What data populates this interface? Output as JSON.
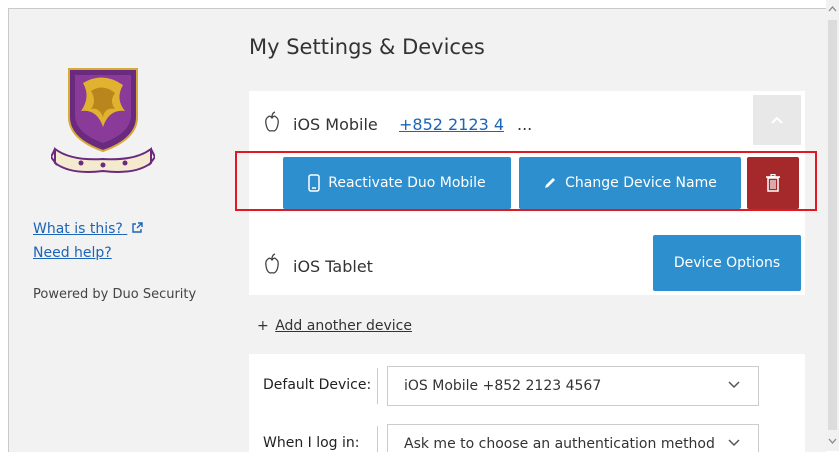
{
  "page": {
    "title": "My Settings & Devices"
  },
  "sidebar": {
    "what_is_this": "What is this?",
    "need_help": "Need help?",
    "powered_by": "Powered by Duo Security"
  },
  "devices": [
    {
      "name": "iOS Mobile",
      "phone": "+852 2123 4",
      "ellipsis": "...",
      "icon": "apple-icon",
      "expanded": true
    },
    {
      "name": "iOS Tablet",
      "icon": "apple-icon",
      "options_label": "Device Options"
    }
  ],
  "device_actions": {
    "reactivate_label": "Reactivate Duo Mobile",
    "rename_label": "Change Device Name",
    "delete_icon": "trash-icon"
  },
  "add_device": {
    "plus": "+",
    "label": "Add another device"
  },
  "settings": {
    "default_device_label": "Default Device:",
    "default_device_value": "iOS Mobile +852 2123 4567",
    "login_label": "When I log in:",
    "login_value": "Ask me to choose an authentication method"
  },
  "colors": {
    "primary": "#2e8fce",
    "danger": "#a5282a",
    "link": "#1b64b7",
    "highlight_border": "#e11a22"
  }
}
